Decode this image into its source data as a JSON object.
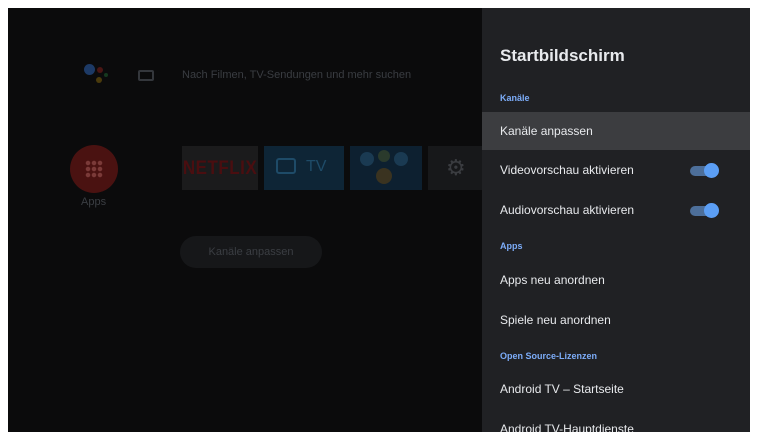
{
  "home": {
    "search_hint": "Nach Filmen, TV-Sendungen und mehr suchen",
    "apps_label": "Apps",
    "netflix_label": "NETFLIX",
    "tv_label": "TV",
    "customize_channels_label": "Kanäle anpassen"
  },
  "panel": {
    "title": "Startbildschirm",
    "sections": {
      "channels": "Kanäle",
      "apps": "Apps",
      "open_source": "Open Source-Lizenzen"
    },
    "items": {
      "customize_channels": "Kanäle anpassen",
      "video_preview": "Videovorschau aktivieren",
      "audio_preview": "Audiovorschau aktivieren",
      "reorder_apps": "Apps neu anordnen",
      "reorder_games": "Spiele neu anordnen",
      "android_tv_home": "Android TV – Startseite",
      "android_tv_core": "Android TV-Hauptdienste"
    },
    "toggles": {
      "video_preview_on": true,
      "audio_preview_on": true
    }
  },
  "colors": {
    "panel_bg": "#202124",
    "section_accent": "#7cacf8",
    "toggle_on": "#5b9ef4",
    "selected_row": "#3c3d40"
  },
  "icons": [
    "google-assistant-icon",
    "keyboard-icon",
    "apps-grid-icon",
    "tv-icon",
    "gear-icon"
  ]
}
